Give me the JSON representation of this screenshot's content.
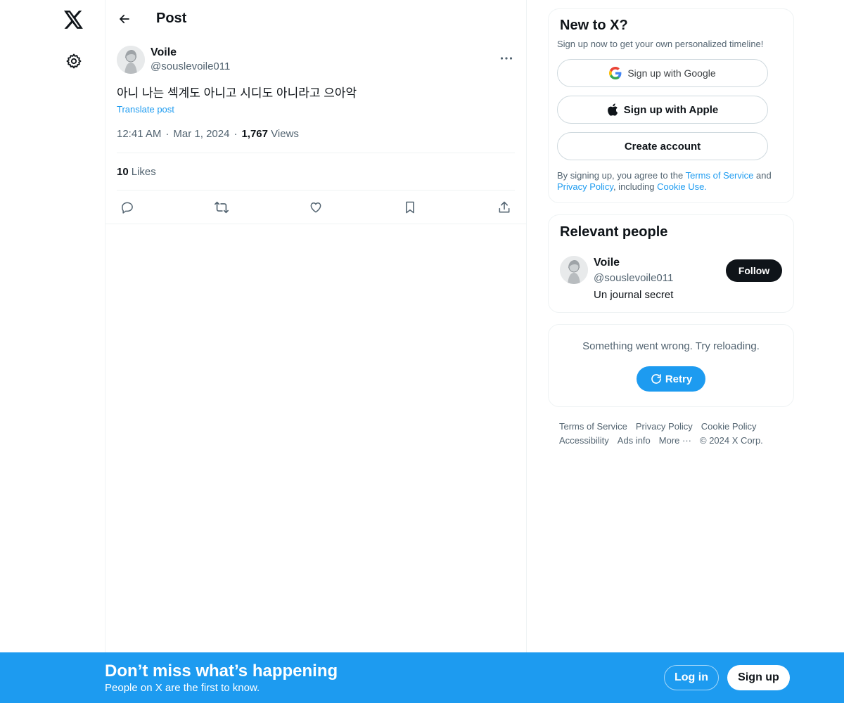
{
  "nav": {
    "logo_icon": "x-logo-icon",
    "settings_icon": "gear-icon"
  },
  "header": {
    "title": "Post"
  },
  "post": {
    "author_name": "Voile",
    "author_handle": "@souslevoile011",
    "text": "아니 나는 섹계도 아니고 시디도 아니라고 으아악",
    "translate": "Translate post",
    "time": "12:41 AM",
    "dot1": "·",
    "date": "Mar 1, 2024",
    "dot2": "·",
    "views_count": "1,767",
    "views_label": "Views",
    "likes_count": "10",
    "likes_label": "Likes"
  },
  "signup_card": {
    "title": "New to X?",
    "subtitle": "Sign up now to get your own personalized timeline!",
    "google_label": "Sign up with Google",
    "apple_label": "Sign up with Apple",
    "create_label": "Create account",
    "terms_prefix": "By signing up, you agree to the ",
    "terms_link": "Terms of Service",
    "terms_and": " and ",
    "privacy_link": "Privacy Policy",
    "terms_including": ", including ",
    "cookie_link": "Cookie Use."
  },
  "people_card": {
    "title": "Relevant people",
    "name": "Voile",
    "handle": "@souslevoile011",
    "bio": "Un journal secret",
    "follow_label": "Follow"
  },
  "error_card": {
    "message": "Something went wrong. Try reloading.",
    "retry_label": "Retry"
  },
  "footer": {
    "links": [
      "Terms of Service",
      "Privacy Policy",
      "Cookie Policy",
      "Accessibility",
      "Ads info",
      "More ···",
      "© 2024 X Corp."
    ]
  },
  "banner": {
    "title": "Don’t miss what’s happening",
    "subtitle": "People on X are the first to know.",
    "login_label": "Log in",
    "signup_label": "Sign up"
  },
  "colors": {
    "accent": "#1d9bf0",
    "text": "#0f1419",
    "secondary": "#536471",
    "border": "#eff3f4"
  }
}
